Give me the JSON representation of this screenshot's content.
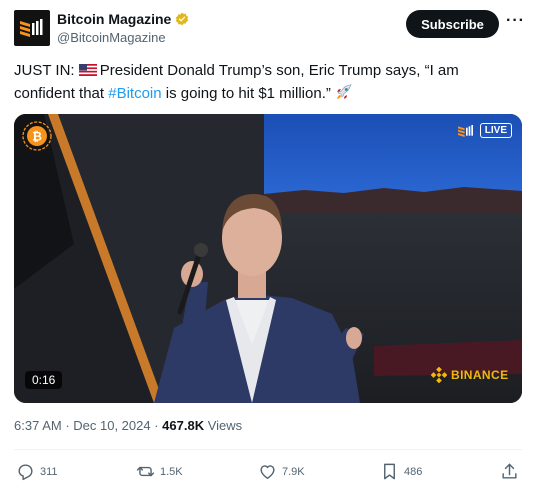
{
  "account": {
    "display_name": "Bitcoin Magazine",
    "handle": "@BitcoinMagazine",
    "verified_icon": "gold-verified-badge-icon"
  },
  "subscribe_label": "Subscribe",
  "more_label": "···",
  "tweet": {
    "prefix": "JUST IN: ",
    "body_1": "President Donald Trump’s son, Eric Trump says, “I am confident that ",
    "hashtag": "#Bitcoin",
    "body_2": " is going to hit $1 million.” ",
    "flag_icon": "us-flag-icon",
    "emoji_icon": "rocket-icon"
  },
  "media": {
    "type": "video",
    "live_label": "LIVE",
    "duration": "0:16",
    "sponsor": "BINANCE"
  },
  "meta": {
    "time": "6:37 AM",
    "separator": " · ",
    "date": "Dec 10, 2024",
    "views_count": "467.8K",
    "views_label": " Views"
  },
  "actions": {
    "replies": "311",
    "reposts": "1.5K",
    "likes": "7.9K",
    "bookmarks": "486"
  },
  "colors": {
    "accent": "#1d9bf0",
    "text": "#0f1419",
    "muted": "#536471",
    "binance": "#f0b90b",
    "verified": "#e2b719"
  }
}
